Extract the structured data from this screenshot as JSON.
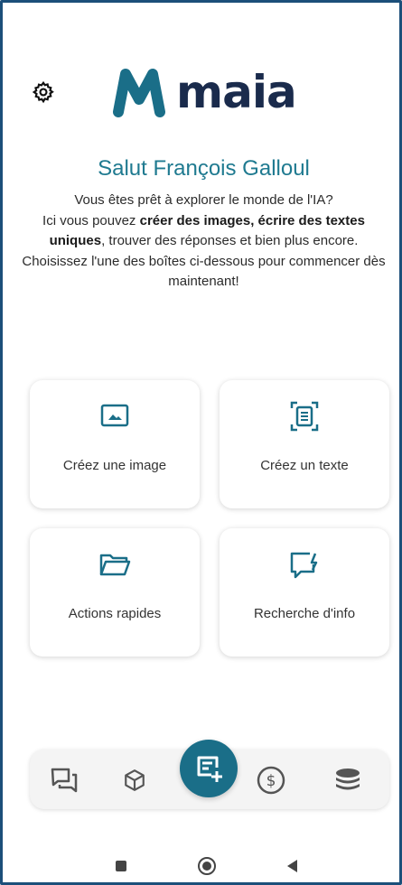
{
  "header": {
    "logo_text": "maia",
    "brand_color": "#1a6e88",
    "icons": {
      "settings": "gear-icon"
    }
  },
  "greeting": "Salut François Galloul",
  "intro": {
    "line1": "Vous êtes prêt à explorer le monde de l'IA?",
    "line2_prefix": "Ici vous pouvez ",
    "line2_bold": "créer des images, écrire des textes uniques",
    "line2_suffix": ", trouver des réponses et bien plus encore.",
    "line3": "Choisissez l'une des boîtes ci-dessous pour commencer dès maintenant!"
  },
  "cards": [
    {
      "label": "Créez une image",
      "icon": "image-icon"
    },
    {
      "label": "Créez un texte",
      "icon": "text-document-icon"
    },
    {
      "label": "Actions rapides",
      "icon": "folder-icon"
    },
    {
      "label": "Recherche d'info",
      "icon": "chat-search-icon"
    }
  ],
  "bottom_nav": {
    "items": [
      "chat-icon",
      "cube-icon",
      "new-note-icon",
      "dollar-icon",
      "database-icon"
    ],
    "active": "new-note-icon"
  },
  "system_nav": [
    "recents-square-icon",
    "home-circle-icon",
    "back-triangle-icon"
  ]
}
